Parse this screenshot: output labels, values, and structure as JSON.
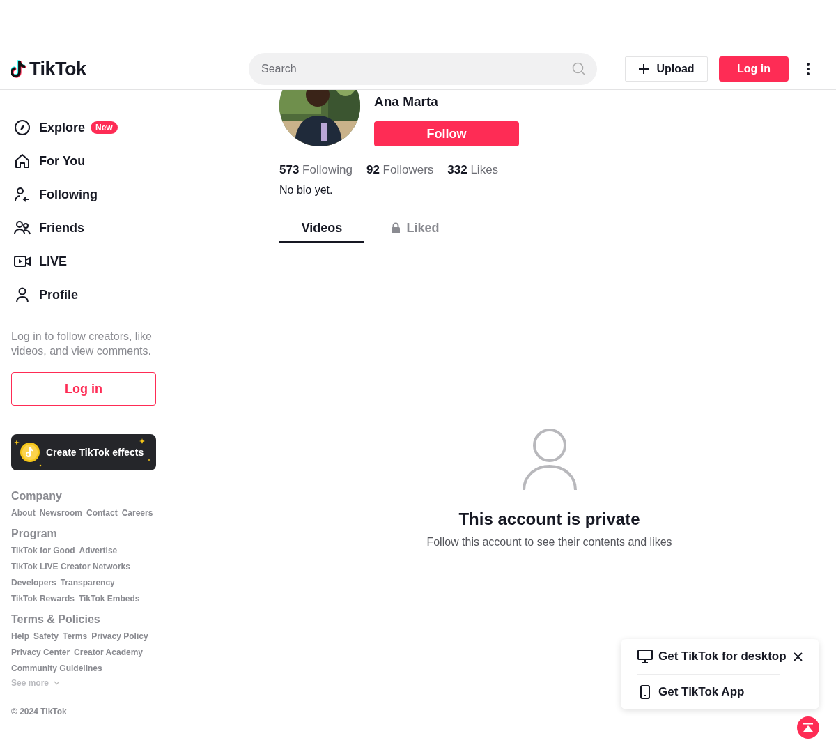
{
  "header": {
    "logo": "TikTok",
    "search": {
      "placeholder": "Search"
    },
    "upload": "Upload",
    "login": "Log in"
  },
  "sidebar": {
    "nav": [
      {
        "kind": "explore",
        "label": "Explore",
        "badge": "New"
      },
      {
        "kind": "home",
        "label": "For You"
      },
      {
        "kind": "following",
        "label": "Following"
      },
      {
        "kind": "friends",
        "label": "Friends"
      },
      {
        "kind": "live",
        "label": "LIVE"
      },
      {
        "kind": "profile",
        "label": "Profile"
      }
    ],
    "login_prompt": "Log in to follow creators, like videos, and view comments.",
    "login_button": "Log in",
    "effects_banner": "Create TikTok effects",
    "footer_groups": [
      {
        "title": "Company",
        "links": [
          "About",
          "Newsroom",
          "Contact",
          "Careers"
        ]
      },
      {
        "title": "Program",
        "links": [
          "TikTok for Good",
          "Advertise",
          "TikTok LIVE Creator Networks",
          "Developers",
          "Transparency",
          "TikTok Rewards",
          "TikTok Embeds"
        ]
      },
      {
        "title": "Terms & Policies",
        "links": [
          "Help",
          "Safety",
          "Terms",
          "Privacy Policy",
          "Privacy Center",
          "Creator Academy",
          "Community Guidelines"
        ]
      }
    ],
    "see_more": "See more",
    "copyright": "© 2024 TikTok"
  },
  "profile": {
    "avatar": {
      "kind": "picture"
    },
    "name": "Ana Marta",
    "follow": "Follow",
    "stats": [
      "**573** Following",
      "**92** Followers",
      "**332** Likes"
    ],
    "bio": "No bio yet.",
    "tabs": [
      {
        "label": "Videos",
        "selected": true,
        "locked": false
      },
      {
        "label": "Liked",
        "selected": false,
        "locked": true
      }
    ],
    "empty_state": {
      "title": "This account is private",
      "message": "Follow this account to see their contents and likes"
    }
  },
  "download_panel": {
    "items": [
      {
        "kind": "desktop",
        "label": "Get TikTok for desktop"
      },
      {
        "kind": "app",
        "label": "Get TikTok App"
      }
    ]
  }
}
